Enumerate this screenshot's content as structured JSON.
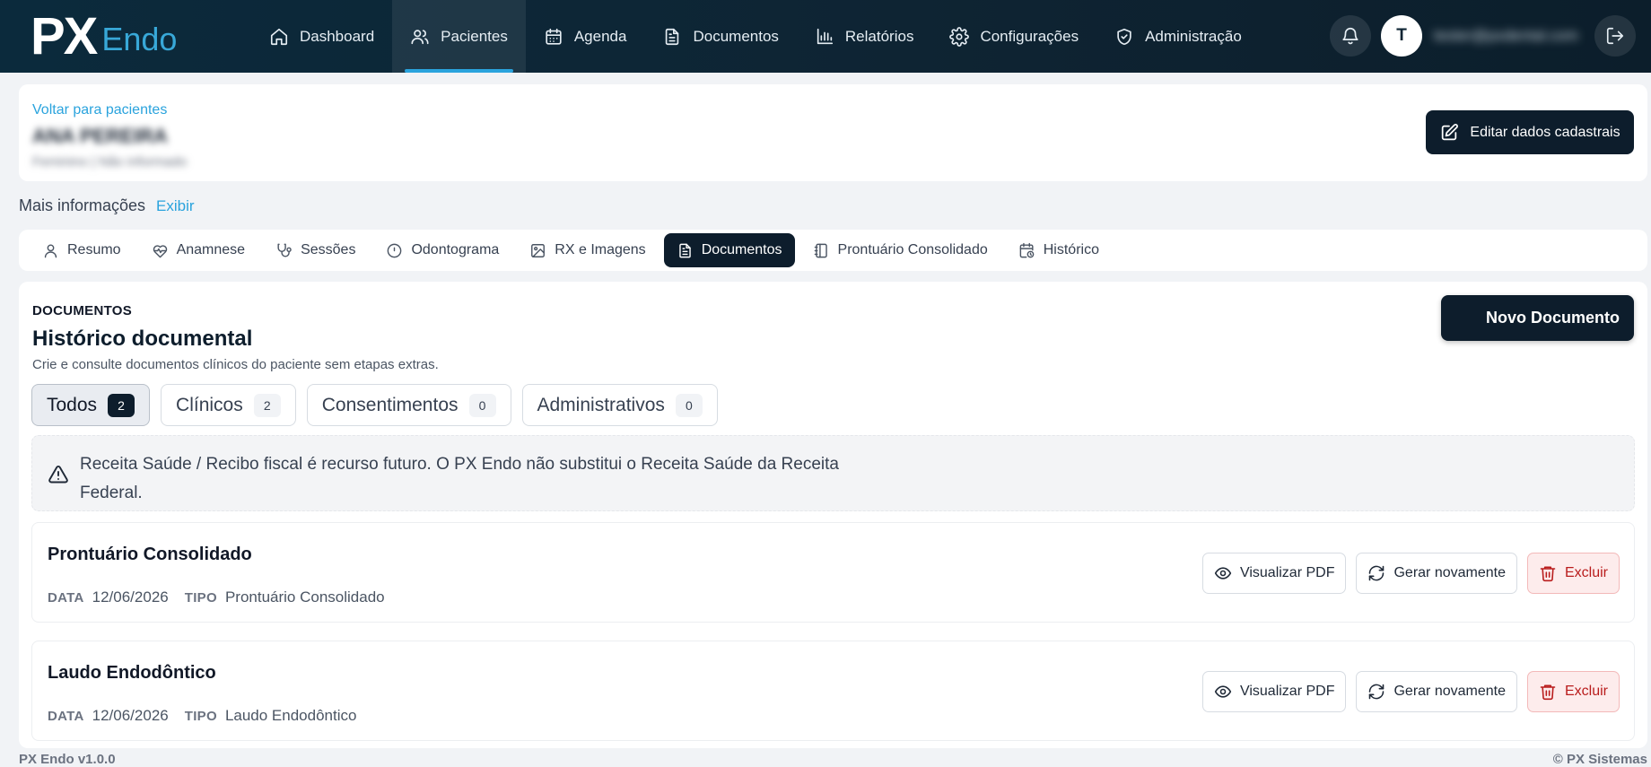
{
  "brand": {
    "logo_px": "PX",
    "logo_endo": "Endo",
    "accent": "#2aa3dd",
    "dark": "#0d1d2c"
  },
  "nav": {
    "items": [
      {
        "label": "Dashboard",
        "icon": "home-icon"
      },
      {
        "label": "Pacientes",
        "icon": "users-icon",
        "active": true
      },
      {
        "label": "Agenda",
        "icon": "calendar-icon"
      },
      {
        "label": "Documentos",
        "icon": "document-icon"
      },
      {
        "label": "Relatórios",
        "icon": "bar-chart-icon"
      },
      {
        "label": "Configurações",
        "icon": "gear-icon"
      },
      {
        "label": "Administração",
        "icon": "shield-icon"
      }
    ],
    "avatar_initial": "T",
    "user_email": "tester@pxdental.com"
  },
  "patient": {
    "back_link": "Voltar para pacientes",
    "name": "ANA PEREIRA",
    "subtitle": "Feminino | Não informado",
    "edit_button": "Editar dados cadastrais"
  },
  "more_info": {
    "label": "Mais informações",
    "link": "Exibir"
  },
  "tabs": [
    {
      "label": "Resumo",
      "icon": "user-icon"
    },
    {
      "label": "Anamnese",
      "icon": "heart-pulse-icon"
    },
    {
      "label": "Sessões",
      "icon": "stethoscope-icon"
    },
    {
      "label": "Odontograma",
      "icon": "circle-icon"
    },
    {
      "label": "RX e Imagens",
      "icon": "image-icon"
    },
    {
      "label": "Documentos",
      "icon": "document-icon",
      "active": true
    },
    {
      "label": "Prontuário Consolidado",
      "icon": "notebook-icon"
    },
    {
      "label": "Histórico",
      "icon": "calendar-clock-icon"
    }
  ],
  "documents": {
    "section_label": "DOCUMENTOS",
    "title": "Histórico documental",
    "description": "Crie e consulte documentos clínicos do paciente sem etapas extras.",
    "new_button": "Novo Documento",
    "filters": [
      {
        "label": "Todos",
        "count": "2",
        "active": true
      },
      {
        "label": "Clínicos",
        "count": "2"
      },
      {
        "label": "Consentimentos",
        "count": "0"
      },
      {
        "label": "Administrativos",
        "count": "0"
      }
    ],
    "notice": "Receita Saúde / Recibo fiscal é recurso futuro. O PX Endo não substitui o Receita Saúde da Receita Federal.",
    "meta_date_key": "DATA",
    "meta_type_key": "TIPO",
    "actions": {
      "view": "Visualizar PDF",
      "regenerate": "Gerar novamente",
      "delete": "Excluir"
    },
    "items": [
      {
        "title": "Prontuário Consolidado",
        "date": "12/06/2026",
        "type": "Prontuário Consolidado"
      },
      {
        "title": "Laudo Endodôntico",
        "date": "12/06/2026",
        "type": "Laudo Endodôntico"
      }
    ]
  },
  "footer": {
    "version": "PX Endo v1.0.0",
    "copyright": "© PX Sistemas"
  }
}
